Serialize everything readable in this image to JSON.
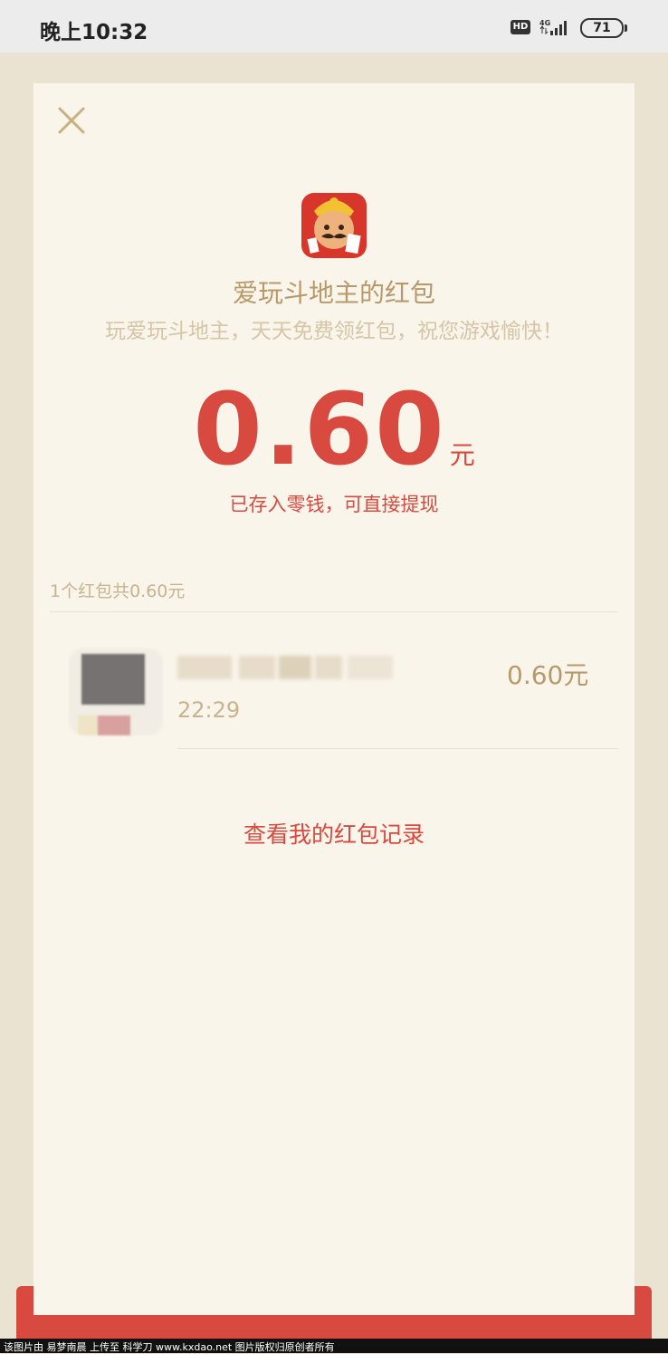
{
  "status_bar": {
    "time": "晚上10:32",
    "hd_label": "HD",
    "network": "4G",
    "battery": "71"
  },
  "packet": {
    "sender_title": "爱玩斗地主的红包",
    "greeting": "玩爱玩斗地主，天天免费领红包，祝您游戏愉快！",
    "amount": "0.60",
    "unit": "元",
    "deposit_note": "已存入零钱，可直接提现"
  },
  "summary": "1个红包共0.60元",
  "record": {
    "time": "22:29",
    "amount": "0.60元"
  },
  "records_link": "查看我的红包记录",
  "watermark": "该图片由 易梦南晨 上传至 科学刀 www.kxdao.net 图片版权归原创者所有",
  "colors": {
    "accent_red": "#d8493f",
    "gold": "#b8996a",
    "card_bg": "#f9f5ea",
    "frame_bg": "#ebe3d2"
  },
  "icons": [
    "close-icon",
    "hd-icon",
    "signal-icon",
    "battery-icon",
    "app-icon"
  ]
}
